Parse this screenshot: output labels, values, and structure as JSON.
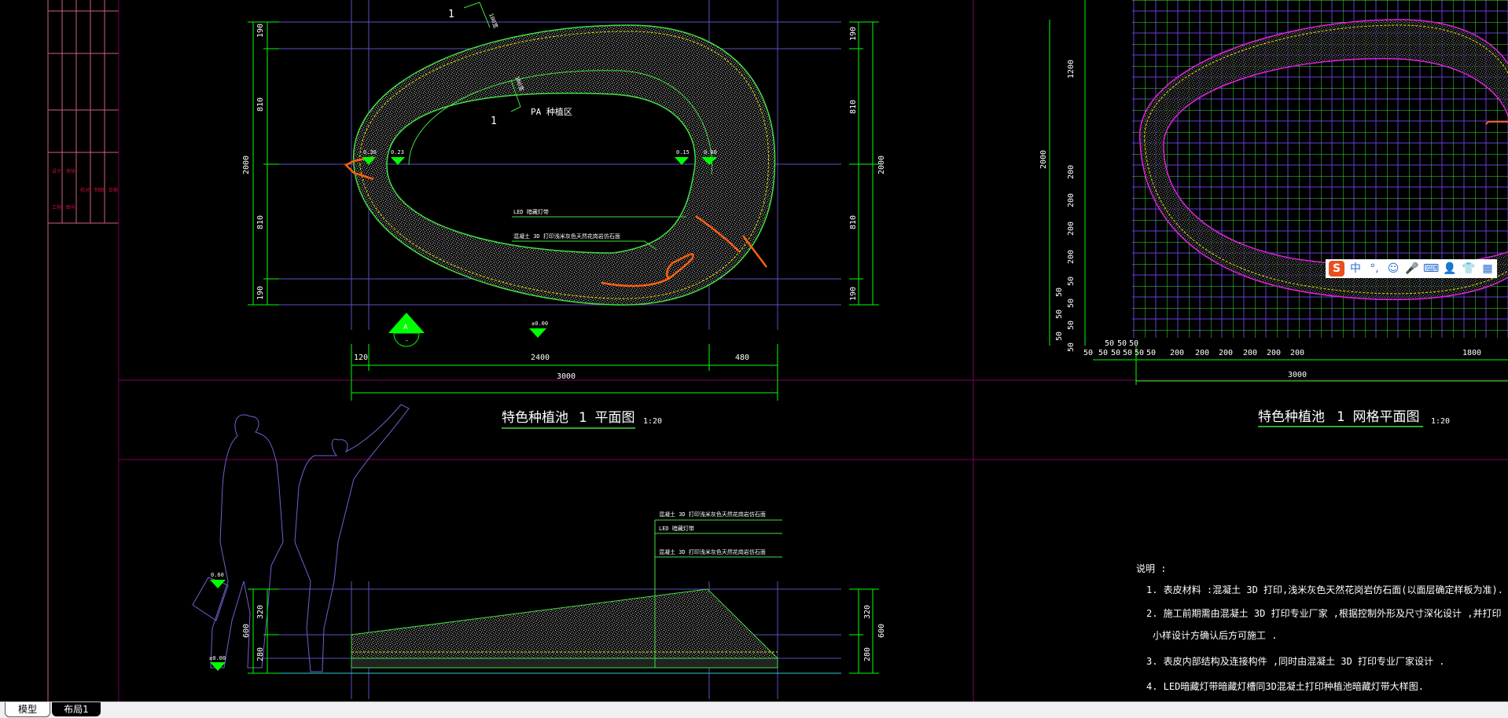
{
  "tabs": [
    {
      "label": "模型"
    },
    {
      "label": "布局1"
    }
  ],
  "title_block": {
    "marks": [
      "设计",
      "审核",
      "校对",
      "制图",
      "日期",
      "工程",
      "图号"
    ],
    "color": "#d0103a"
  },
  "plan": {
    "title": "特色种植池",
    "subtitle": "1 平面图",
    "scale": "1:20",
    "left_dims": [
      "190",
      "810",
      "2000",
      "810",
      "190"
    ],
    "right_dims": [
      "190",
      "810",
      "2000",
      "810",
      "190"
    ],
    "bottom_dims": [
      "120",
      "2400",
      "480"
    ],
    "bottom_total": "3000",
    "callouts": [
      "1",
      "1",
      "100宽",
      "100宽"
    ],
    "zone_label": "PA 种植区",
    "levels": [
      "0.30",
      "0.23",
      "0.15",
      "0.00"
    ],
    "section_marker": "A",
    "section_sub": "-",
    "level_bottom": "±0.00",
    "leaders": [
      "LED 暗藏灯带",
      "混凝土  3D 打印浅米灰色天然花岗岩仿石面"
    ]
  },
  "grid_plan": {
    "title": "特色种植池",
    "subtitle": "1 网格平面图",
    "scale": "1:20",
    "left_dims": [
      "1200",
      "2000",
      "200",
      "200",
      "200",
      "200",
      "50",
      "50",
      "50",
      "50",
      "50",
      "50",
      "50"
    ],
    "top_dims": [
      "50",
      "50",
      "50"
    ],
    "bottom_dims": [
      "50",
      "50",
      "50",
      "50",
      "50",
      "50",
      "200",
      "200",
      "200",
      "200",
      "200",
      "200",
      "1800"
    ],
    "bottom_total": "3000",
    "ring_color": "#e020e0",
    "grid_color": "#40e040",
    "subgrid_color": "#6040d0"
  },
  "section": {
    "left_dims": [
      "320",
      "280",
      "600"
    ],
    "right_dims": [
      "320",
      "280",
      "600"
    ],
    "levels": [
      "0.60",
      "±0.00"
    ],
    "leaders": [
      "混凝土  3D 打印浅米灰色天然花岗岩仿石面",
      "LED 暗藏灯带",
      "混凝土  3D 打印浅米灰色天然花岗岩仿石面"
    ]
  },
  "notes": {
    "heading": "说明 :",
    "lines": [
      "1. 表皮材料    :混凝土    3D 打印,浅米灰色天然花岗岩仿石面(以面层确定样板为准).",
      "2. 施工前期需由混凝土          3D 打印专业厂家          ,根据控制外形及尺寸深化设计                    ,并打印",
      "小样设计方确认后方可施工              .",
      "3. 表皮内部结构及连接构件                  ,同时由混凝土        3D 打印专业厂家设计            .",
      "4. LED暗藏灯带暗藏灯槽同3D混凝土打印种植池暗藏灯带大样图."
    ]
  },
  "ime": {
    "icons": [
      "sogou-logo-icon",
      "chinese-mode-icon",
      "punctuation-icon",
      "emoji-icon",
      "microphone-icon",
      "keyboard-icon",
      "user-icon",
      "skin-icon",
      "toolbox-icon"
    ],
    "labels": [
      "S",
      "中",
      "°,",
      "☺",
      "🎤",
      "⌨",
      "👤",
      "👕",
      "▦"
    ]
  },
  "colors": {
    "background": "#000000",
    "dim": "#00ff00",
    "ring": "#40e040",
    "accent": "#ff6010",
    "ref": "#6050c0",
    "frame": "#800060"
  }
}
